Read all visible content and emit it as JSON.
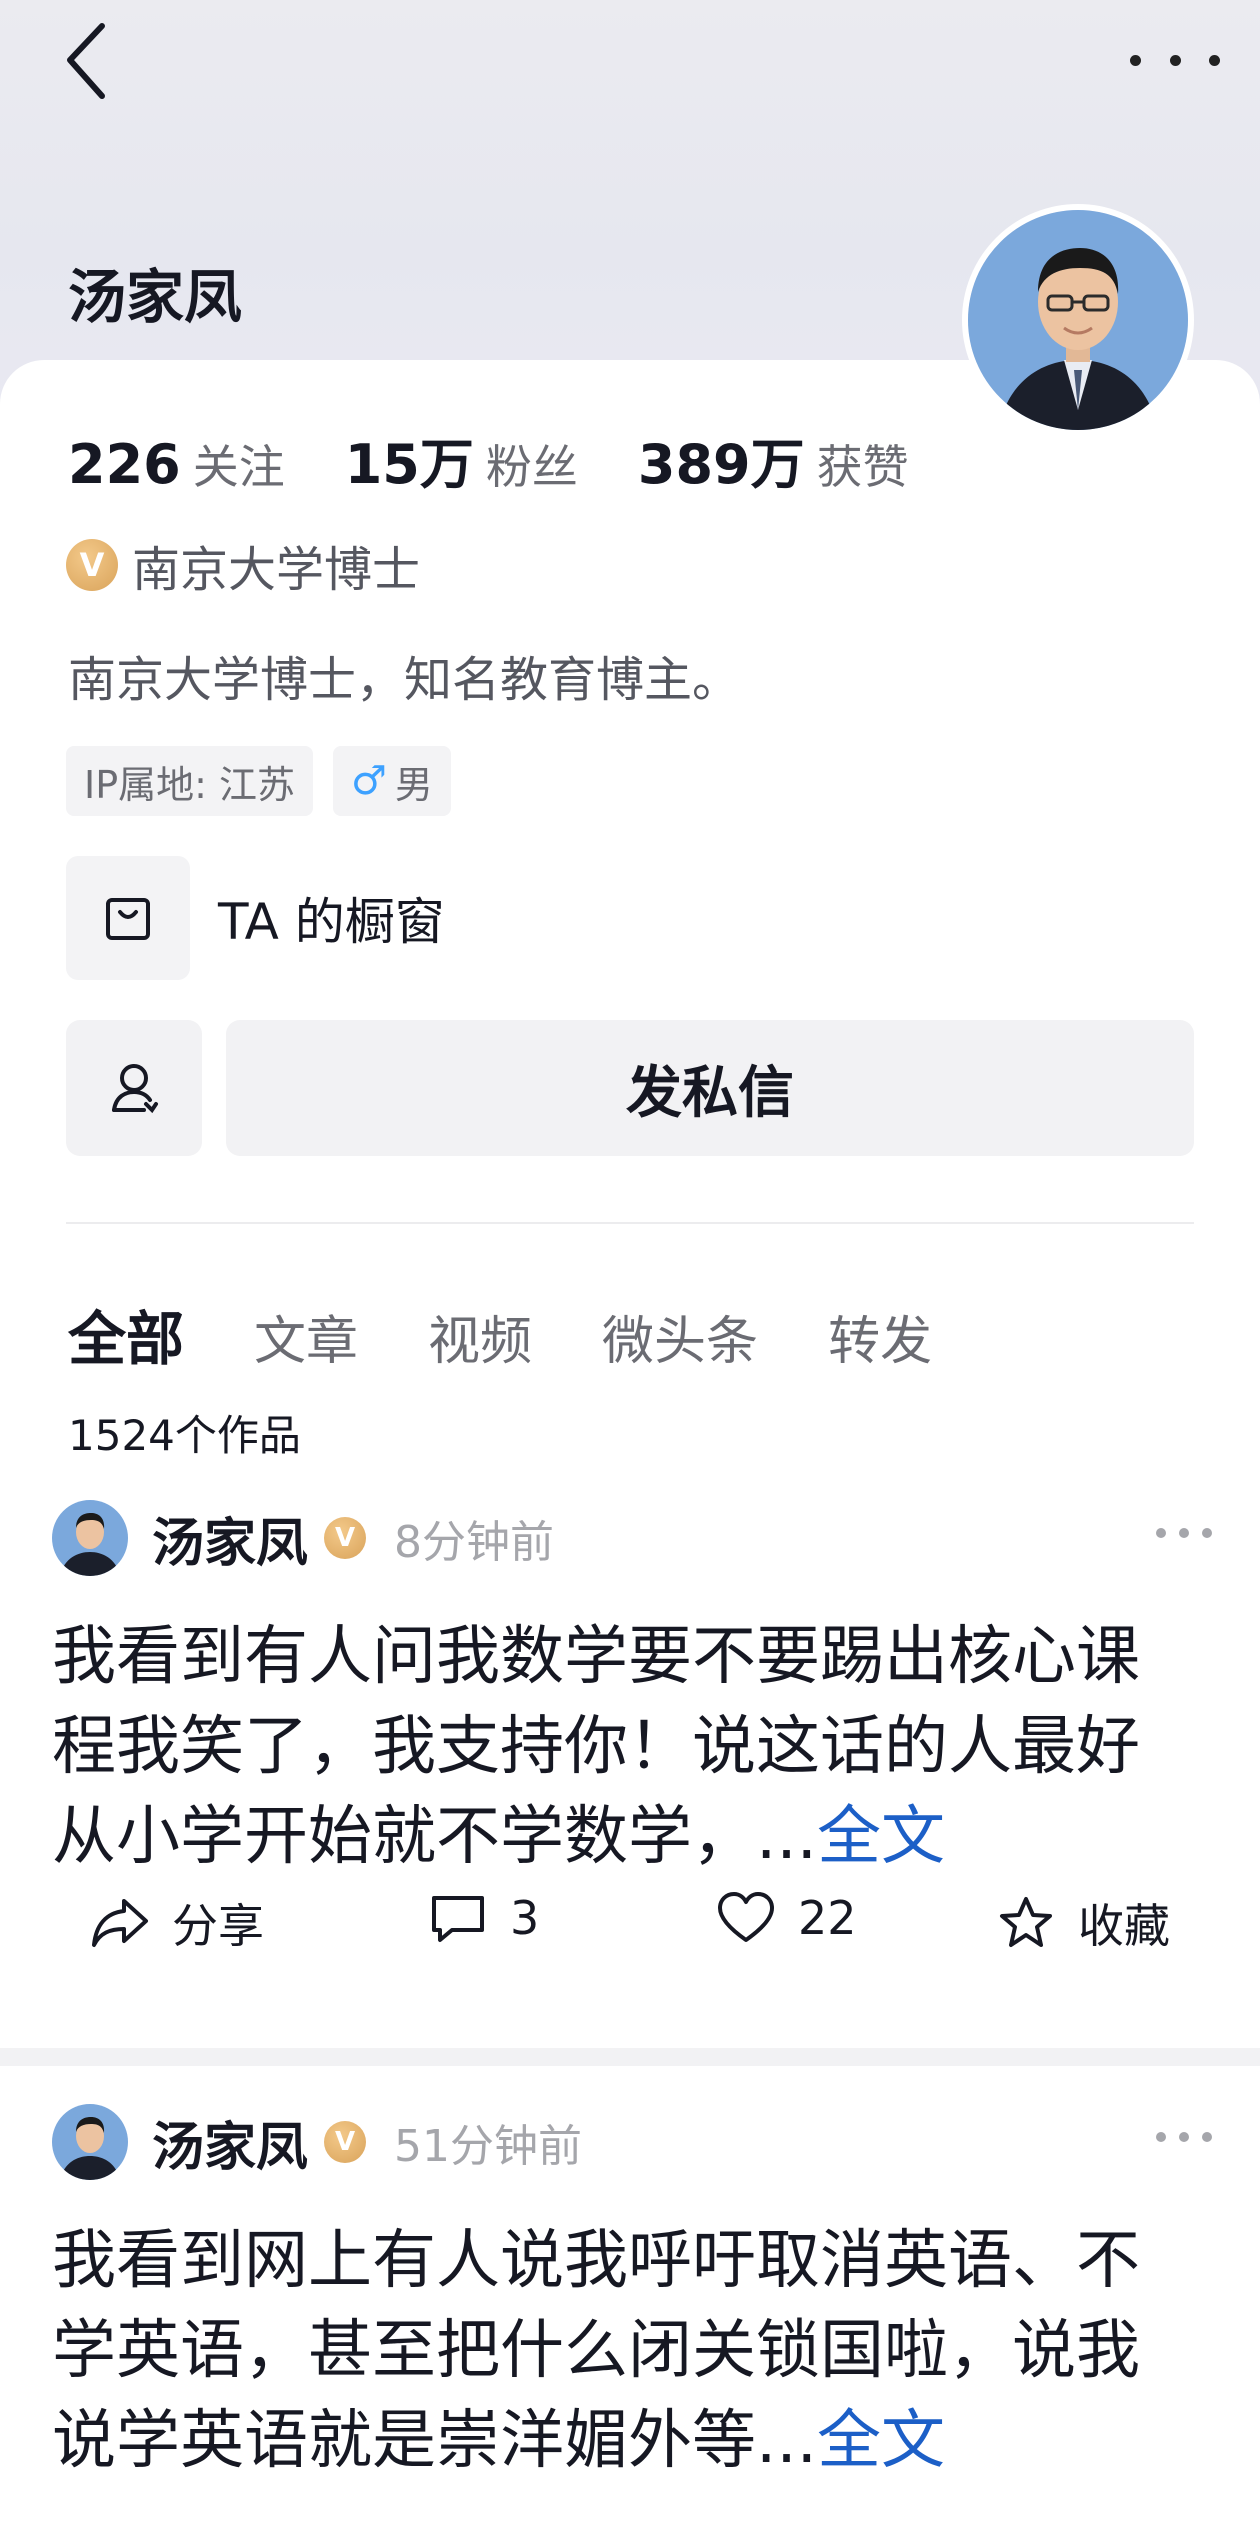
{
  "header": {
    "back_icon": "chevron-left-icon",
    "more_icon": "more-dots-icon"
  },
  "profile": {
    "name": "汤家凤",
    "avatar_icon": "profile-avatar",
    "stats": [
      {
        "num": "226",
        "label": "关注"
      },
      {
        "num": "15万",
        "label": "粉丝"
      },
      {
        "num": "389万",
        "label": "获赞"
      }
    ],
    "verified_badge": "V",
    "verified_text": "南京大学博士",
    "bio": "南京大学博士，知名教育博主。",
    "tags": {
      "ip": "IP属地: 江苏",
      "gender_symbol": "♂",
      "gender": "男"
    },
    "shop_label": "TA 的橱窗",
    "message_button": "发私信"
  },
  "tabs": [
    {
      "label": "全部",
      "active": true
    },
    {
      "label": "文章",
      "active": false
    },
    {
      "label": "视频",
      "active": false
    },
    {
      "label": "微头条",
      "active": false
    },
    {
      "label": "转发",
      "active": false
    }
  ],
  "works_count": "1524个作品",
  "posts": [
    {
      "author": "汤家凤",
      "time": "8分钟前",
      "text": "我看到有人问我数学要不要踢出核心课程我笑了，我支持你！说这话的人最好从小学开始就不学数学，...",
      "full_link": "全文",
      "share": "分享",
      "comments": "3",
      "likes": "22",
      "favorite": "收藏"
    },
    {
      "author": "汤家凤",
      "time": "51分钟前",
      "text": "我看到网上有人说我呼吁取消英语、不学英语，甚至把什么闭关锁国啦，说我说学英语就是崇洋媚外等...",
      "full_link": "全文"
    }
  ],
  "colors": {
    "link": "#1c5fc7",
    "badge_gold": "#d9a35a",
    "gender_blue": "#3da1ff"
  }
}
